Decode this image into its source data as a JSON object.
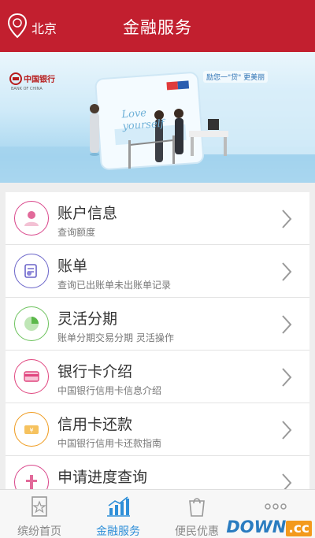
{
  "header": {
    "location": "北京",
    "title": "金融服务"
  },
  "banner": {
    "bank_name_cn": "中国银行",
    "bank_name_en": "BANK OF CHINA",
    "card_text": "Love yourself",
    "slogan": "励您一\"贷\" 更美丽"
  },
  "menu": [
    {
      "title": "账户信息",
      "subtitle": "查询额度",
      "icon": "user-icon",
      "color": "#d9458a"
    },
    {
      "title": "账单",
      "subtitle": "查询已出账单未出账单记录",
      "icon": "bill-icon",
      "color": "#6a64c9"
    },
    {
      "title": "灵活分期",
      "subtitle": "账单分期交易分期 灵活操作",
      "icon": "pie-chart-icon",
      "color": "#6cc25c"
    },
    {
      "title": "银行卡介绍",
      "subtitle": "中国银行信用卡信息介绍",
      "icon": "card-icon",
      "color": "#e0467f"
    },
    {
      "title": "信用卡还款",
      "subtitle": "中国银行信用卡还款指南",
      "icon": "money-icon",
      "color": "#ef9a1c"
    },
    {
      "title": "申请进度查询",
      "subtitle": "",
      "icon": "progress-icon",
      "color": "#d9458a"
    }
  ],
  "tabs": [
    {
      "label": "缤纷首页",
      "icon": "star-icon"
    },
    {
      "label": "金融服务",
      "icon": "bar-chart-icon",
      "active": true
    },
    {
      "label": "便民优惠",
      "icon": "bag-icon"
    },
    {
      "label": "",
      "icon": "more-icon"
    }
  ],
  "watermark": {
    "main": "DOWN",
    "suffix": ".cc"
  }
}
